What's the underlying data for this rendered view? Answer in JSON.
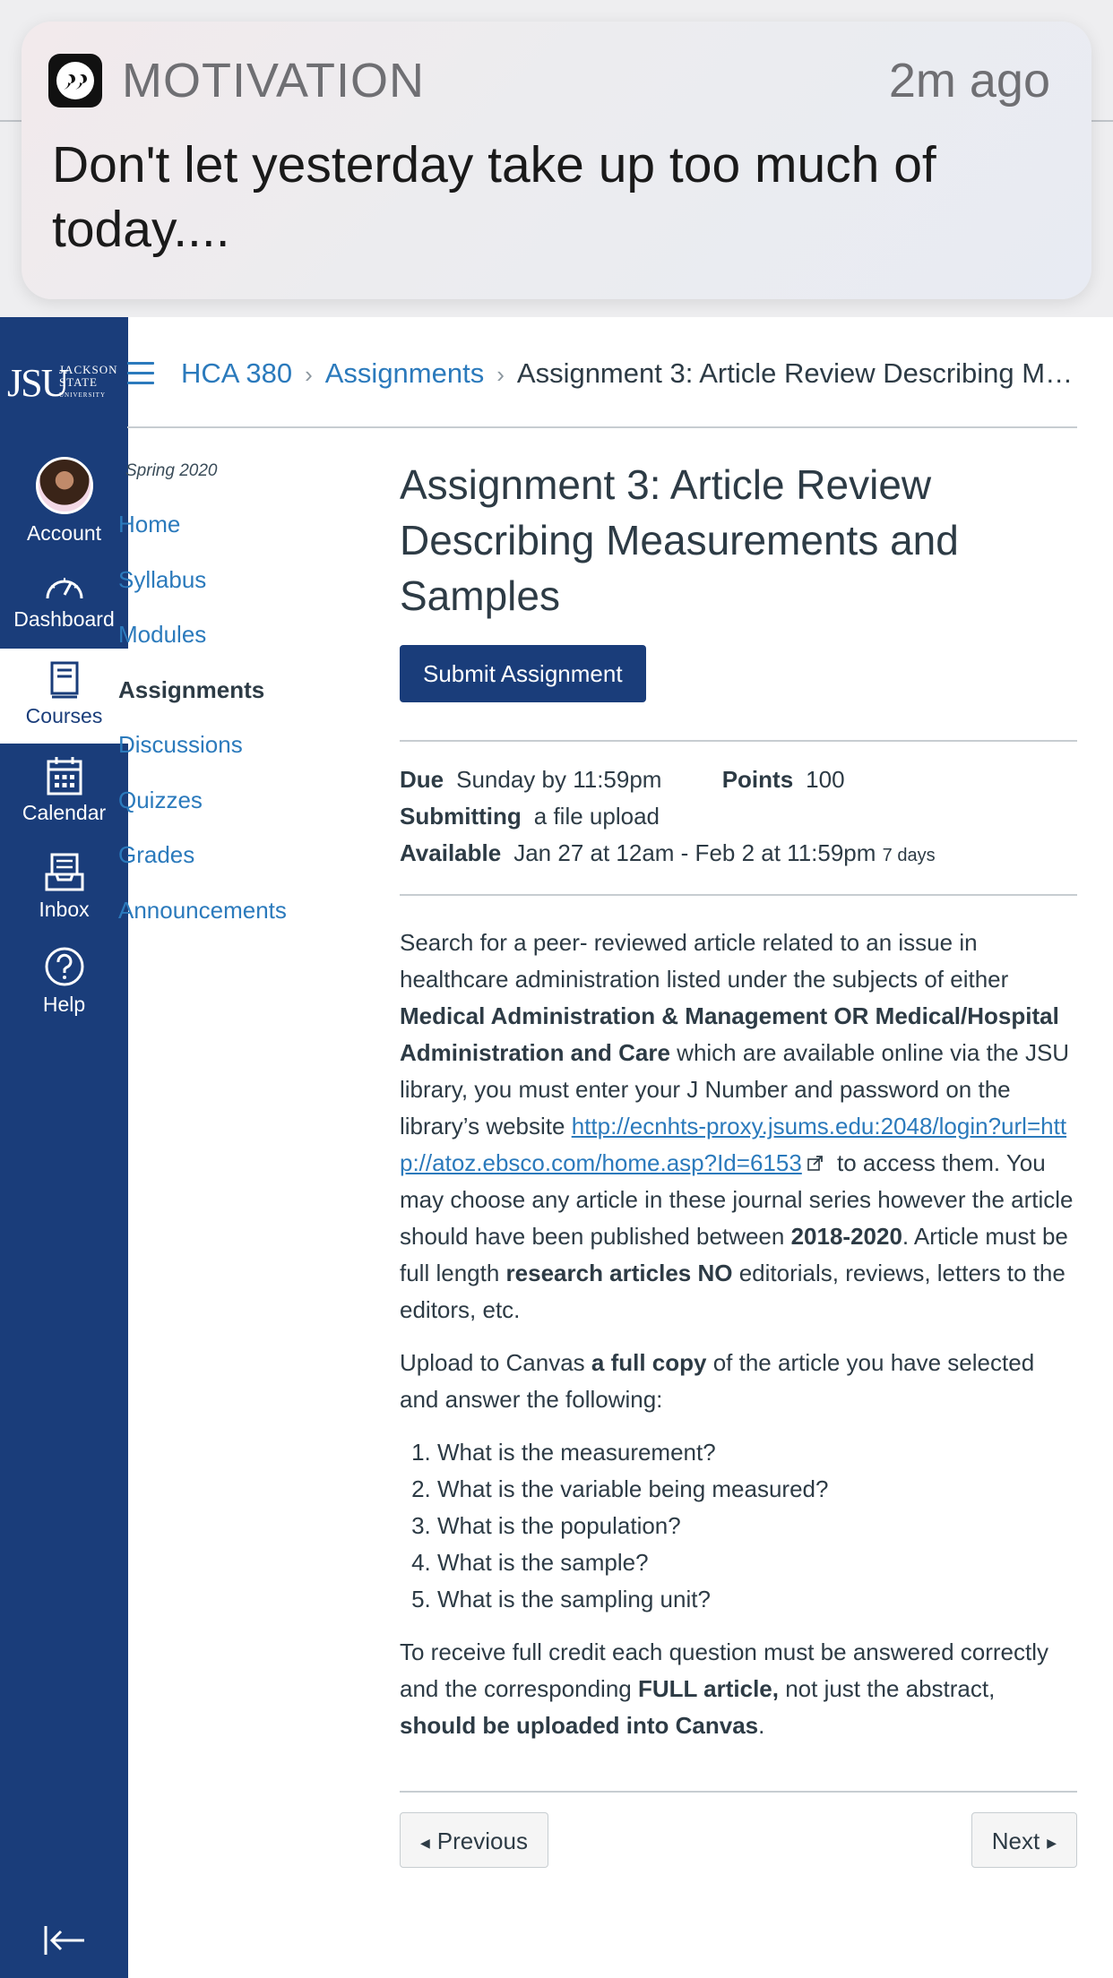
{
  "notification": {
    "app": "MOTIVATION",
    "time": "2m ago",
    "message": "Don't let yesterday take up too much of today...."
  },
  "global_nav": {
    "logo_text": "JSU",
    "logo_name_1": "JACKSON",
    "logo_name_2": "STATE",
    "logo_name_3": "UNIVERSITY",
    "items": [
      {
        "label": "Account",
        "icon": "avatar"
      },
      {
        "label": "Dashboard",
        "icon": "speedometer-icon"
      },
      {
        "label": "Courses",
        "icon": "book-icon",
        "active": true
      },
      {
        "label": "Calendar",
        "icon": "calendar-icon"
      },
      {
        "label": "Inbox",
        "icon": "inbox-icon"
      },
      {
        "label": "Help",
        "icon": "help-icon"
      }
    ],
    "colors": {
      "nav_bg": "#1a3d7a",
      "link": "#2b7abc"
    }
  },
  "breadcrumb": {
    "course": "HCA 380",
    "section": "Assignments",
    "current": "Assignment 3: Article Review Describing M…"
  },
  "course_nav": {
    "term": "Spring 2020",
    "links": [
      "Home",
      "Syllabus",
      "Modules",
      "Assignments",
      "Discussions",
      "Quizzes",
      "Grades",
      "Announcements"
    ],
    "active": "Assignments"
  },
  "assignment": {
    "title": "Assignment 3: Article Review Describing Measurements and Samples",
    "submit_label": "Submit Assignment",
    "due_label": "Due",
    "due_value": "Sunday by 11:59pm",
    "points_label": "Points",
    "points_value": "100",
    "submitting_label": "Submitting",
    "submitting_value": "a file upload",
    "available_label": "Available",
    "available_value": "Jan 27 at 12am - Feb 2 at 11:59pm",
    "available_duration": "7 days"
  },
  "description": {
    "p1_a": "Search for a peer- reviewed article related to an issue in healthcare administration listed under the subjects of either ",
    "p1_b": "Medical Administration & Management OR Medical/Hospital Administration and Care",
    "p1_c": " which are available online via the JSU library, you must enter your J Number and password on the library’s website ",
    "p1_link": "http://ecnhts-proxy.jsums.edu:2048/login?url=http://atoz.ebsco.com/home.asp?Id=6153",
    "p1_d": " to access them. You may choose any article in these journal series however the article should have been published between ",
    "p1_e": "2018-2020",
    "p1_f": ". Article must be full length ",
    "p1_g": "research articles NO",
    "p1_h": " editorials, reviews, letters to the editors, etc.",
    "p2_a": "Upload to Canvas ",
    "p2_b": "a full copy",
    "p2_c": " of the article you have selected and answer the following:",
    "questions": [
      "What is the measurement?",
      "What is the variable being measured?",
      "What is the population?",
      "What is the sample?",
      "What is the sampling unit?"
    ],
    "p3_a": "To receive full credit each question must be answered correctly and the corresponding ",
    "p3_b": "FULL article,",
    "p3_c": " not just the abstract, ",
    "p3_d": "should be uploaded into Canvas",
    "p3_e": "."
  },
  "pager": {
    "previous": "Previous",
    "next": "Next"
  }
}
